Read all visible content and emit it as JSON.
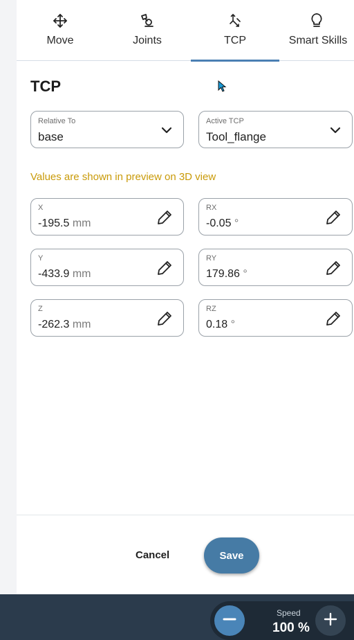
{
  "tabs": [
    {
      "label": "Move",
      "icon": "move-arrows-icon"
    },
    {
      "label": "Joints",
      "icon": "robot-joint-icon"
    },
    {
      "label": "TCP",
      "icon": "tcp-axes-icon",
      "active": true
    },
    {
      "label": "Smart Skills",
      "icon": "lightbulb-icon"
    }
  ],
  "page": {
    "title": "TCP",
    "notice": "Values are shown in preview on 3D view"
  },
  "relative_to": {
    "caption": "Relative To",
    "value": "base"
  },
  "active_tcp": {
    "caption": "Active TCP",
    "value": "Tool_flange"
  },
  "fields": {
    "x": {
      "caption": "X",
      "value": "-195.5",
      "unit": "mm"
    },
    "y": {
      "caption": "Y",
      "value": "-433.9",
      "unit": "mm"
    },
    "z": {
      "caption": "Z",
      "value": "-262.3",
      "unit": "mm"
    },
    "rx": {
      "caption": "RX",
      "value": "-0.05",
      "unit": "°"
    },
    "ry": {
      "caption": "RY",
      "value": "179.86",
      "unit": "°"
    },
    "rz": {
      "caption": "RZ",
      "value": "0.18",
      "unit": "°"
    }
  },
  "actions": {
    "cancel": "Cancel",
    "save": "Save"
  },
  "speed": {
    "label": "Speed",
    "value": "100 %"
  },
  "colors": {
    "accent": "#467ba5",
    "notice": "#c99a08",
    "bottom_bar": "#2b3b4c",
    "active_tab_underline": "#4a7fb3"
  }
}
